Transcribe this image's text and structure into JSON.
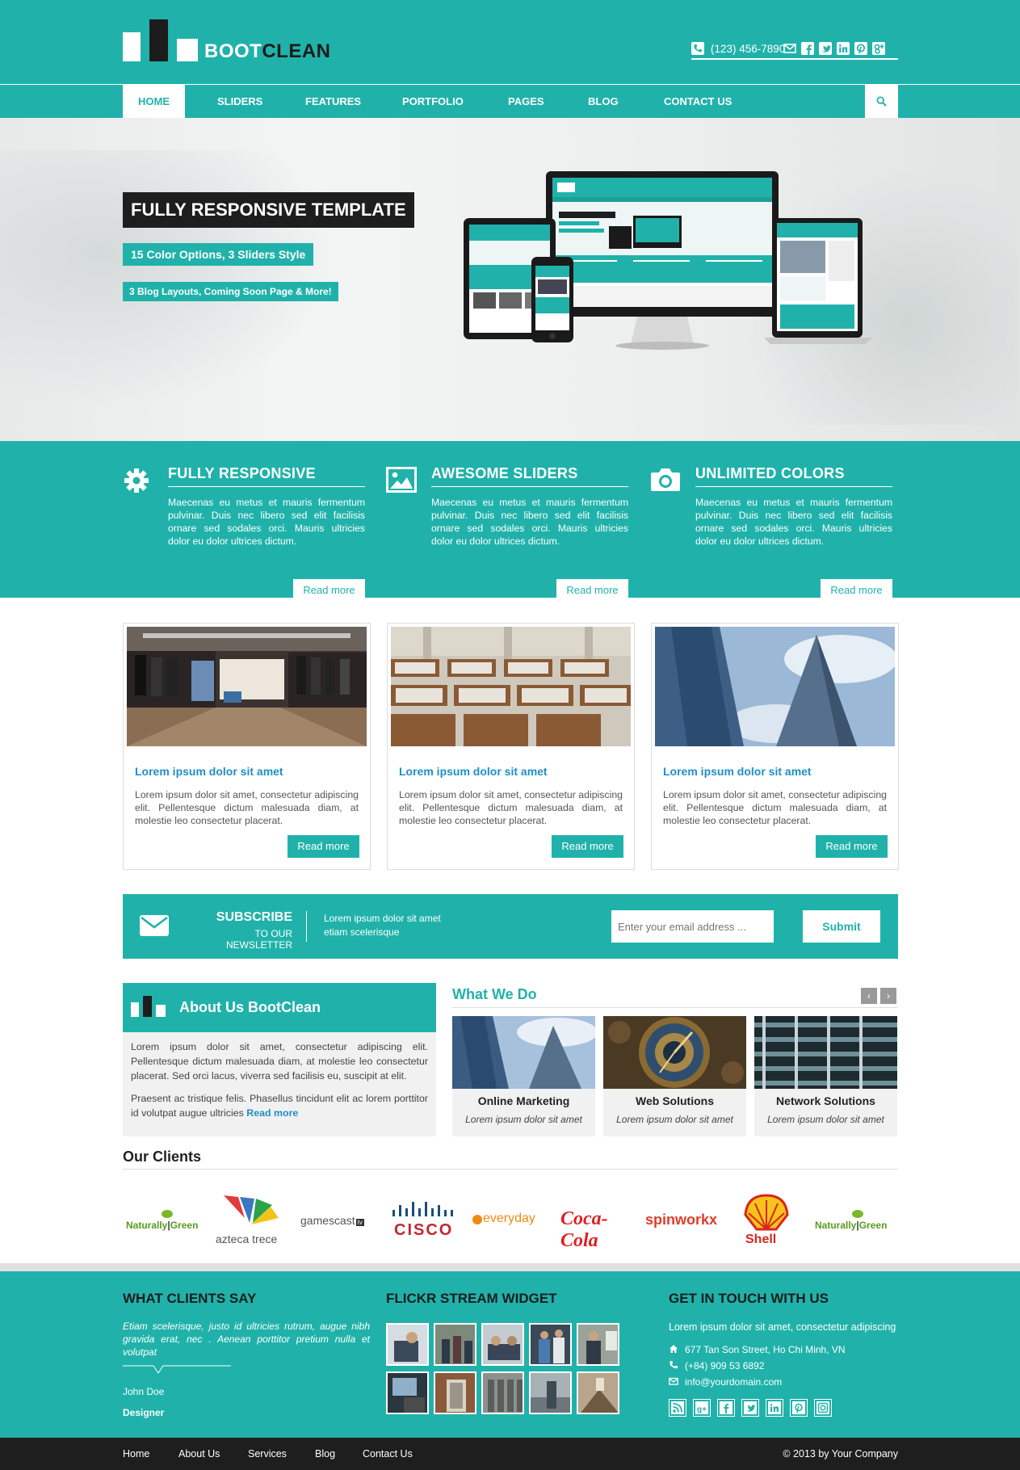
{
  "brand": {
    "name_part1": "BOOT",
    "name_part2": "CLEAN",
    "accent": "#20b2aa",
    "dark": "#1e1e1e",
    "link": "#1e8fc7"
  },
  "topbar": {
    "phone": "(123) 456-7890",
    "icons": [
      "phone-icon",
      "email-icon",
      "facebook-icon",
      "twitter-icon",
      "linkedin-icon",
      "pinterest-icon",
      "google-plus-icon"
    ]
  },
  "nav": {
    "items": [
      "HOME",
      "SLIDERS",
      "FEATURES",
      "PORTFOLIO",
      "PAGES",
      "BLOG",
      "CONTACT US"
    ],
    "active": "HOME"
  },
  "hero": {
    "heading": "FULLY RESPONSIVE TEMPLATE",
    "sub1": "15 Color Options, 3 Sliders Style",
    "sub2": "3 Blog Layouts, Coming Soon Page & More!"
  },
  "features": [
    {
      "icon": "gear-icon",
      "title": "FULLY RESPONSIVE",
      "text": "Maecenas eu metus et mauris fermentum pulvinar. Duis nec libero sed elit facilisis ornare sed sodales orci. Mauris ultricies dolor eu dolor ultrices dictum.",
      "button": "Read more"
    },
    {
      "icon": "image-icon",
      "title": "AWESOME SLIDERS",
      "text": "Maecenas eu metus et mauris fermentum pulvinar. Duis nec libero sed elit facilisis ornare sed sodales orci. Mauris ultricies dolor eu dolor ultrices dictum.",
      "button": "Read more"
    },
    {
      "icon": "camera-icon",
      "title": "UNLIMITED COLORS",
      "text": "Maecenas eu metus et mauris fermentum pulvinar. Duis nec libero sed elit facilisis ornare sed sodales orci. Mauris ultricies dolor eu dolor ultrices dictum.",
      "button": "Read more"
    }
  ],
  "cards": [
    {
      "title": "Lorem ipsum dolor sit amet",
      "text": "Lorem ipsum dolor sit amet, consectetur adipiscing elit. Pellentesque dictum malesuada diam, at molestie leo consectetur placerat.",
      "button": "Read more"
    },
    {
      "title": "Lorem ipsum dolor sit amet",
      "text": "Lorem ipsum dolor sit amet, consectetur adipiscing elit. Pellentesque dictum malesuada diam, at molestie leo consectetur placerat.",
      "button": "Read more"
    },
    {
      "title": "Lorem ipsum dolor sit amet",
      "text": "Lorem ipsum dolor sit amet, consectetur adipiscing elit. Pellentesque dictum malesuada diam, at molestie leo consectetur placerat.",
      "button": "Read more"
    }
  ],
  "newsletter": {
    "title": "SUBSCRIBE",
    "subtitle": "TO OUR NEWSLETTER",
    "text_line1": "Lorem ipsum dolor sit amet",
    "text_line2": "etiam scelerisque",
    "placeholder": "Enter your email address ...",
    "button": "Submit"
  },
  "about": {
    "title": "About Us BootClean",
    "p1": "Lorem ipsum dolor sit amet, consectetur adipiscing elit. Pellentesque dictum malesuada diam, at molestie leo consectetur placerat. Sed orci lacus, viverra sed facilisis eu, suscipit at elit.",
    "p2": "Praesent ac tristique felis. Phasellus tincidunt elit ac lorem porttitor id volutpat augue ultricies ",
    "read_more": "Read more"
  },
  "what_we_do": {
    "title": "What We Do",
    "prev": "‹",
    "next": "›",
    "items": [
      {
        "title": "Online Marketing",
        "text": "Lorem ipsum dolor sit amet"
      },
      {
        "title": "Web Solutions",
        "text": "Lorem ipsum dolor sit amet"
      },
      {
        "title": "Network Solutions",
        "text": "Lorem ipsum dolor sit amet"
      }
    ]
  },
  "clients": {
    "title": "Our Clients",
    "logos": [
      {
        "name": "Naturally Green",
        "text": "Naturally",
        "text2": "Green"
      },
      {
        "name": "azteca trece",
        "text": "azteca",
        "text2": "trece"
      },
      {
        "name": "gamescast",
        "text": "gamescast",
        "text2": "tv"
      },
      {
        "name": "Cisco",
        "text": "CISCO",
        "text2": ""
      },
      {
        "name": "everyday",
        "text": "everyday",
        "text2": ""
      },
      {
        "name": "Coca-Cola",
        "text": "Coca-Cola",
        "text2": ""
      },
      {
        "name": "spinworkx",
        "text": "spinworkx",
        "text2": ""
      },
      {
        "name": "Shell",
        "text": "Shell",
        "text2": ""
      },
      {
        "name": "Naturally Green",
        "text": "Naturally",
        "text2": "Green"
      }
    ]
  },
  "footer": {
    "clients_say": {
      "title": "WHAT CLIENTS SAY",
      "quote": "Etiam scelerisque, justo id ultricies rutrum, augue nibh gravida erat, nec . Aenean porttitor pretium nulla et volutpat",
      "name": "John Doe",
      "role": "Designer"
    },
    "flickr": {
      "title": "FLICKR STREAM WIDGET"
    },
    "contact": {
      "title": "GET IN TOUCH WITH US",
      "text": "Lorem ipsum dolor sit amet, consectetur adipiscing",
      "address": "677 Tan Son Street, Ho Chi Minh, VN",
      "phone": "(+84) 909 53 6892",
      "email": "info@yourdomain.com",
      "social": [
        "rss-icon",
        "google-plus-icon",
        "facebook-icon",
        "twitter-icon",
        "linkedin-icon",
        "pinterest-icon",
        "instagram-icon"
      ]
    }
  },
  "bottom": {
    "links": [
      "Home",
      "About Us",
      "Services",
      "Blog",
      "Contact Us"
    ],
    "copyright": "© 2013 by Your Company"
  }
}
